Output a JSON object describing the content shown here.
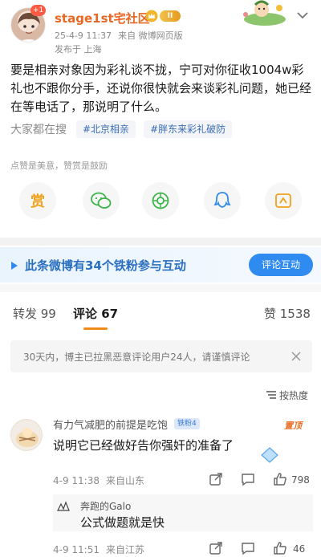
{
  "post": {
    "avatar_badge": "+1",
    "username": "stage1st宅社区",
    "level_badge": "II",
    "time": "25-4-9 11:37",
    "source": "来自 微博网页版",
    "location": "发布于 上海",
    "text": "要是相亲对象因为彩礼谈不拢，宁可对你征收1004w彩礼也不跟你分手，还说你很快就会来谈彩礼问题，她已经在等电话了，那说明了什么。"
  },
  "trends": {
    "label": "大家都在搜",
    "tags": [
      "#北京相亲",
      "#胖东来彩礼破防"
    ]
  },
  "reward": {
    "hint": "点赞是美意，赞赏是鼓励",
    "reward_glyph": "赏"
  },
  "share_icons": [
    "reward-icon",
    "wechat-icon",
    "moments-icon",
    "qq-icon",
    "qzone-icon"
  ],
  "fan_banner": {
    "text": "此条微博有34个铁粉参与互动",
    "button": "评论互动"
  },
  "tabs": {
    "repost": "转发 99",
    "comment": "评论 67",
    "like": "赞 1538"
  },
  "notice": "30天内，博主已拉黑恶意评论用户24人，请谨慎评论",
  "sort": {
    "label": "按热度"
  },
  "comments": [
    {
      "name": "有力气减肥的前提是吃饱",
      "fan_badge": "铁粉4",
      "top_badge": "置顶",
      "text": "说明它已经做好告你强奸的准备了",
      "time": "4-9 11:38",
      "location": "来自山东",
      "likes": "798"
    },
    {
      "reply_name": "奔跑的Galo",
      "reply_text": "公式做题就是快",
      "time": "4-9 11:51",
      "location": "来自江苏",
      "likes": "46"
    }
  ],
  "colors": {
    "username": "#e86722",
    "accent_blue": "#2f8bef",
    "tag_blue": "#3b6db3",
    "tab_underline": "#f08a1c"
  }
}
